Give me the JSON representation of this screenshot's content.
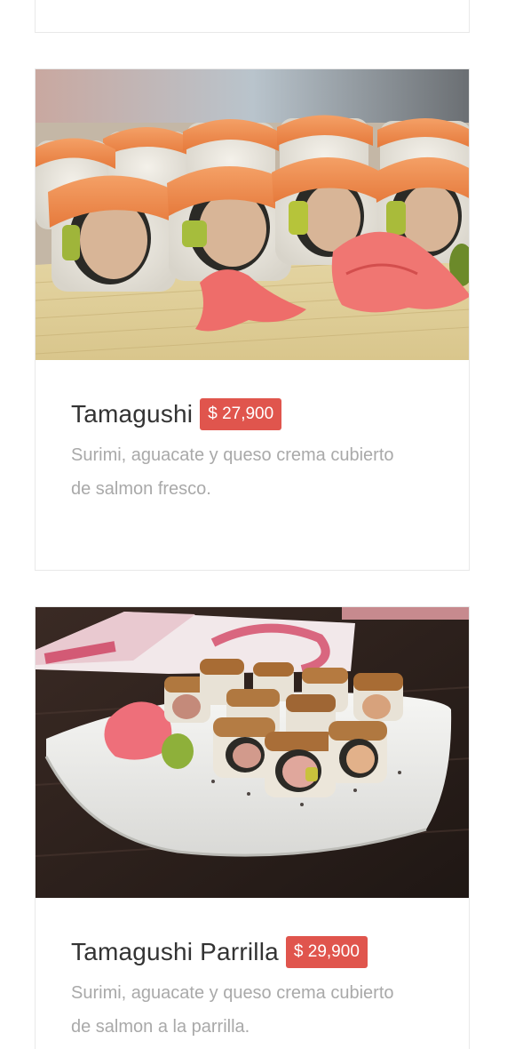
{
  "colors": {
    "price_badge": "#e0554d",
    "title_text": "#333333",
    "description_text": "#a9a9a9"
  },
  "menu_items": [
    {
      "name": "Tamagushi",
      "price": "$ 27,900",
      "description_lines": [
        "Surimi, aguacate y queso crema cubierto",
        "de salmon fresco."
      ],
      "image": "sushi-rolls-salmon-photo"
    },
    {
      "name": "Tamagushi Parrilla",
      "price": "$ 29,900",
      "description_lines": [
        "Surimi, aguacate y queso crema cubierto",
        "de salmon a la parrilla."
      ],
      "image": "grilled-sushi-plate-photo"
    }
  ]
}
